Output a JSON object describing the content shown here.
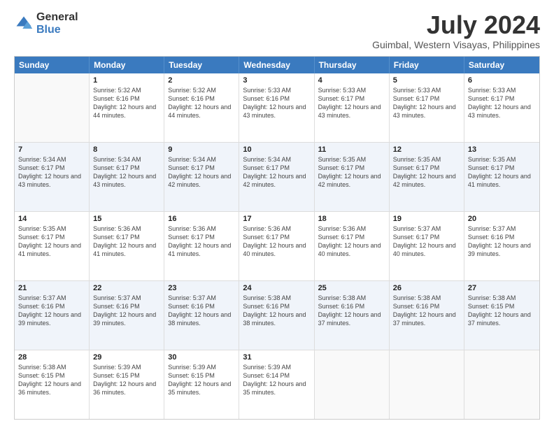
{
  "logo": {
    "general": "General",
    "blue": "Blue"
  },
  "title": "July 2024",
  "subtitle": "Guimbal, Western Visayas, Philippines",
  "header_days": [
    "Sunday",
    "Monday",
    "Tuesday",
    "Wednesday",
    "Thursday",
    "Friday",
    "Saturday"
  ],
  "rows": [
    [
      {
        "day": "",
        "sunrise": "",
        "sunset": "",
        "daylight": "",
        "empty": true
      },
      {
        "day": "1",
        "sunrise": "Sunrise: 5:32 AM",
        "sunset": "Sunset: 6:16 PM",
        "daylight": "Daylight: 12 hours and 44 minutes."
      },
      {
        "day": "2",
        "sunrise": "Sunrise: 5:32 AM",
        "sunset": "Sunset: 6:16 PM",
        "daylight": "Daylight: 12 hours and 44 minutes."
      },
      {
        "day": "3",
        "sunrise": "Sunrise: 5:33 AM",
        "sunset": "Sunset: 6:16 PM",
        "daylight": "Daylight: 12 hours and 43 minutes."
      },
      {
        "day": "4",
        "sunrise": "Sunrise: 5:33 AM",
        "sunset": "Sunset: 6:17 PM",
        "daylight": "Daylight: 12 hours and 43 minutes."
      },
      {
        "day": "5",
        "sunrise": "Sunrise: 5:33 AM",
        "sunset": "Sunset: 6:17 PM",
        "daylight": "Daylight: 12 hours and 43 minutes."
      },
      {
        "day": "6",
        "sunrise": "Sunrise: 5:33 AM",
        "sunset": "Sunset: 6:17 PM",
        "daylight": "Daylight: 12 hours and 43 minutes."
      }
    ],
    [
      {
        "day": "7",
        "sunrise": "Sunrise: 5:34 AM",
        "sunset": "Sunset: 6:17 PM",
        "daylight": "Daylight: 12 hours and 43 minutes."
      },
      {
        "day": "8",
        "sunrise": "Sunrise: 5:34 AM",
        "sunset": "Sunset: 6:17 PM",
        "daylight": "Daylight: 12 hours and 43 minutes."
      },
      {
        "day": "9",
        "sunrise": "Sunrise: 5:34 AM",
        "sunset": "Sunset: 6:17 PM",
        "daylight": "Daylight: 12 hours and 42 minutes."
      },
      {
        "day": "10",
        "sunrise": "Sunrise: 5:34 AM",
        "sunset": "Sunset: 6:17 PM",
        "daylight": "Daylight: 12 hours and 42 minutes."
      },
      {
        "day": "11",
        "sunrise": "Sunrise: 5:35 AM",
        "sunset": "Sunset: 6:17 PM",
        "daylight": "Daylight: 12 hours and 42 minutes."
      },
      {
        "day": "12",
        "sunrise": "Sunrise: 5:35 AM",
        "sunset": "Sunset: 6:17 PM",
        "daylight": "Daylight: 12 hours and 42 minutes."
      },
      {
        "day": "13",
        "sunrise": "Sunrise: 5:35 AM",
        "sunset": "Sunset: 6:17 PM",
        "daylight": "Daylight: 12 hours and 41 minutes."
      }
    ],
    [
      {
        "day": "14",
        "sunrise": "Sunrise: 5:35 AM",
        "sunset": "Sunset: 6:17 PM",
        "daylight": "Daylight: 12 hours and 41 minutes."
      },
      {
        "day": "15",
        "sunrise": "Sunrise: 5:36 AM",
        "sunset": "Sunset: 6:17 PM",
        "daylight": "Daylight: 12 hours and 41 minutes."
      },
      {
        "day": "16",
        "sunrise": "Sunrise: 5:36 AM",
        "sunset": "Sunset: 6:17 PM",
        "daylight": "Daylight: 12 hours and 41 minutes."
      },
      {
        "day": "17",
        "sunrise": "Sunrise: 5:36 AM",
        "sunset": "Sunset: 6:17 PM",
        "daylight": "Daylight: 12 hours and 40 minutes."
      },
      {
        "day": "18",
        "sunrise": "Sunrise: 5:36 AM",
        "sunset": "Sunset: 6:17 PM",
        "daylight": "Daylight: 12 hours and 40 minutes."
      },
      {
        "day": "19",
        "sunrise": "Sunrise: 5:37 AM",
        "sunset": "Sunset: 6:17 PM",
        "daylight": "Daylight: 12 hours and 40 minutes."
      },
      {
        "day": "20",
        "sunrise": "Sunrise: 5:37 AM",
        "sunset": "Sunset: 6:16 PM",
        "daylight": "Daylight: 12 hours and 39 minutes."
      }
    ],
    [
      {
        "day": "21",
        "sunrise": "Sunrise: 5:37 AM",
        "sunset": "Sunset: 6:16 PM",
        "daylight": "Daylight: 12 hours and 39 minutes."
      },
      {
        "day": "22",
        "sunrise": "Sunrise: 5:37 AM",
        "sunset": "Sunset: 6:16 PM",
        "daylight": "Daylight: 12 hours and 39 minutes."
      },
      {
        "day": "23",
        "sunrise": "Sunrise: 5:37 AM",
        "sunset": "Sunset: 6:16 PM",
        "daylight": "Daylight: 12 hours and 38 minutes."
      },
      {
        "day": "24",
        "sunrise": "Sunrise: 5:38 AM",
        "sunset": "Sunset: 6:16 PM",
        "daylight": "Daylight: 12 hours and 38 minutes."
      },
      {
        "day": "25",
        "sunrise": "Sunrise: 5:38 AM",
        "sunset": "Sunset: 6:16 PM",
        "daylight": "Daylight: 12 hours and 37 minutes."
      },
      {
        "day": "26",
        "sunrise": "Sunrise: 5:38 AM",
        "sunset": "Sunset: 6:16 PM",
        "daylight": "Daylight: 12 hours and 37 minutes."
      },
      {
        "day": "27",
        "sunrise": "Sunrise: 5:38 AM",
        "sunset": "Sunset: 6:15 PM",
        "daylight": "Daylight: 12 hours and 37 minutes."
      }
    ],
    [
      {
        "day": "28",
        "sunrise": "Sunrise: 5:38 AM",
        "sunset": "Sunset: 6:15 PM",
        "daylight": "Daylight: 12 hours and 36 minutes."
      },
      {
        "day": "29",
        "sunrise": "Sunrise: 5:39 AM",
        "sunset": "Sunset: 6:15 PM",
        "daylight": "Daylight: 12 hours and 36 minutes."
      },
      {
        "day": "30",
        "sunrise": "Sunrise: 5:39 AM",
        "sunset": "Sunset: 6:15 PM",
        "daylight": "Daylight: 12 hours and 35 minutes."
      },
      {
        "day": "31",
        "sunrise": "Sunrise: 5:39 AM",
        "sunset": "Sunset: 6:14 PM",
        "daylight": "Daylight: 12 hours and 35 minutes."
      },
      {
        "day": "",
        "sunrise": "",
        "sunset": "",
        "daylight": "",
        "empty": true
      },
      {
        "day": "",
        "sunrise": "",
        "sunset": "",
        "daylight": "",
        "empty": true
      },
      {
        "day": "",
        "sunrise": "",
        "sunset": "",
        "daylight": "",
        "empty": true
      }
    ]
  ]
}
